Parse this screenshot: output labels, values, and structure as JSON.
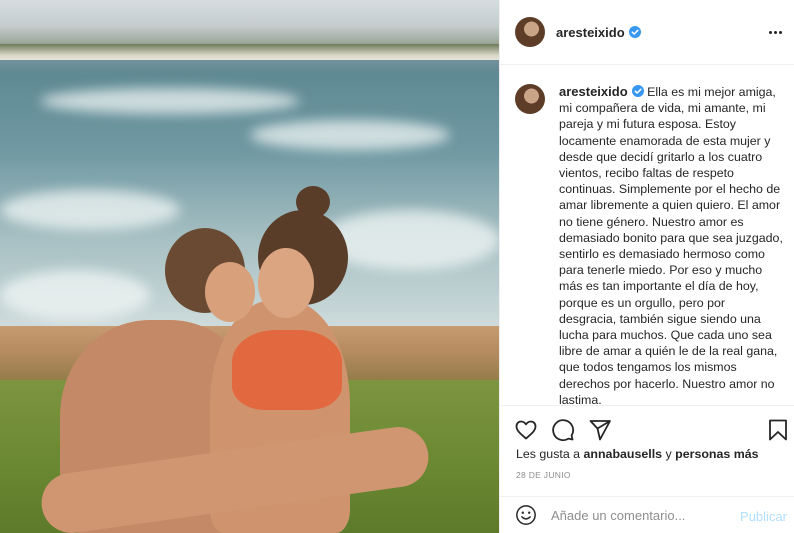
{
  "post": {
    "username": "aresteixido",
    "verified_icon": "verified-badge-icon",
    "caption": "Ella es mi mejor amiga, mi compañera de vida, mi amante, mi pareja y mi futura esposa. Estoy locamente enamorada de esta mujer y desde que decidí gritarlo a los cuatro vientos, recibo faltas de respeto continuas. Simplemente por el hecho de amar libremente a quien quiero. El amor no tiene género. Nuestro amor es demasiado bonito para que sea juzgado, sentirlo es demasiado hermoso como para tenerle miedo. Por eso y mucho más es tan importante el día de hoy, porque es un orgullo, pero por desgracia, también sigue siendo una lucha para muchos. Que cada uno sea libre de amar a quién le de la real gana, que todos tengamos los mismos derechos por hacerlo. Nuestro amor no lastima.",
    "likes_prefix": "Les gusta a",
    "likes_user": "annabausells",
    "likes_joiner": "y",
    "likes_more": "personas más",
    "date": "28 DE JUNIO"
  },
  "comment_box": {
    "placeholder": "Añade un comentario...",
    "publish_label": "Publicar"
  },
  "icons": {
    "like": "heart-icon",
    "comment": "comment-icon",
    "share": "paper-plane-icon",
    "save": "bookmark-icon",
    "emoji": "emoji-icon",
    "more": "more-options-icon"
  },
  "colors": {
    "verified": "#3897f0",
    "publish_disabled": "#b2dffc",
    "text": "#262626",
    "muted": "#8e8e8e"
  }
}
